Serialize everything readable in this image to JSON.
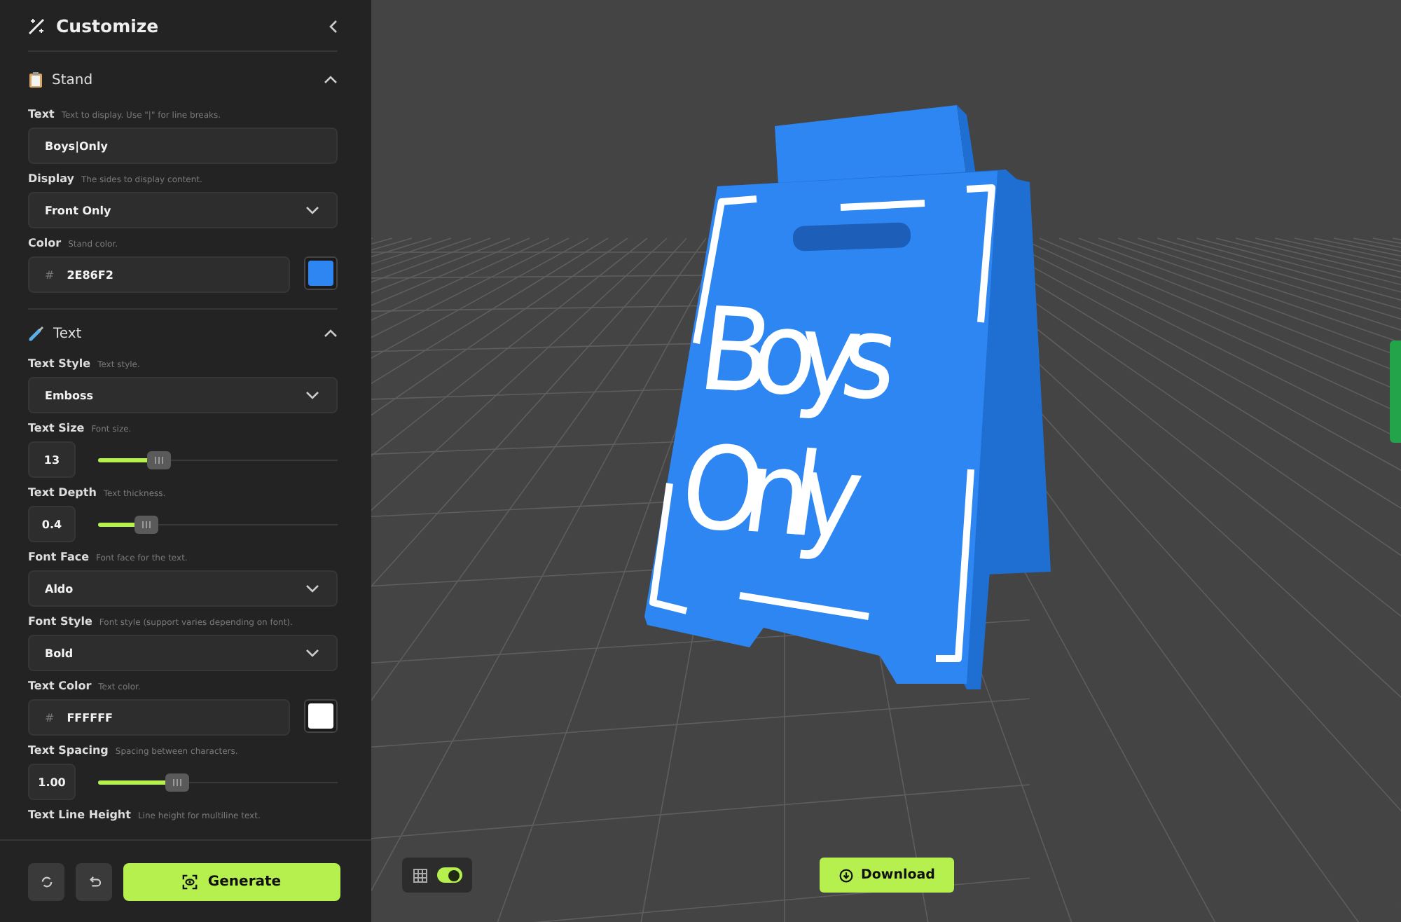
{
  "panel": {
    "title": "Customize",
    "sections": [
      {
        "title": "Stand",
        "expanded": true,
        "fields": [
          {
            "kind": "text",
            "label": "Text",
            "hint": "Text to display. Use \"|\" for line breaks.",
            "value": "Boys|Only"
          },
          {
            "kind": "select",
            "label": "Display",
            "hint": "The sides to display content.",
            "value": "Front Only"
          },
          {
            "kind": "color",
            "label": "Color",
            "hint": "Stand color.",
            "prefix": "#",
            "value": "2E86F2"
          }
        ]
      },
      {
        "title": "Text",
        "expanded": true,
        "fields": [
          {
            "kind": "select",
            "label": "Text Style",
            "hint": "Text style.",
            "value": "Emboss"
          },
          {
            "kind": "slider",
            "label": "Text Size",
            "hint": "Font size.",
            "value": "13",
            "level": 0.25
          },
          {
            "kind": "slider",
            "label": "Text Depth",
            "hint": "Text thickness.",
            "value": "0.4",
            "level": 0.2
          },
          {
            "kind": "select",
            "label": "Font Face",
            "hint": "Font face for the text.",
            "value": "Aldo"
          },
          {
            "kind": "select",
            "label": "Font Style",
            "hint": "Font style (support varies depending on font).",
            "value": "Bold"
          },
          {
            "kind": "color",
            "label": "Text Color",
            "hint": "Text color.",
            "prefix": "#",
            "value": "FFFFFF"
          },
          {
            "kind": "slider",
            "label": "Text Spacing",
            "hint": "Spacing between characters.",
            "value": "1.00",
            "level": 0.33
          },
          {
            "kind": "label",
            "label": "Text Line Height",
            "hint": "Line height for multiline text."
          }
        ]
      }
    ],
    "generate": "Generate"
  },
  "viewport": {
    "grid_toggle": {
      "on": true
    },
    "download": "Download",
    "model_text": [
      "Boys",
      "Only"
    ]
  }
}
